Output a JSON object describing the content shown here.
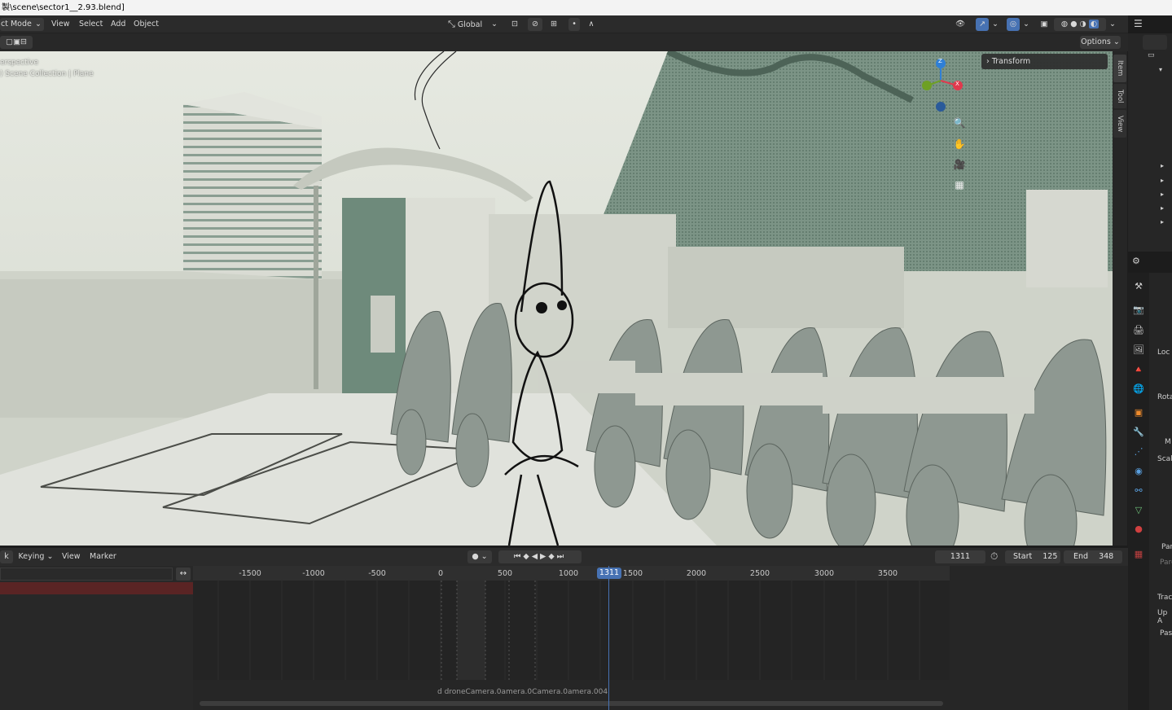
{
  "window": {
    "title": "製\\scene\\sector1__2.93.blend]"
  },
  "header": {
    "mode": "ct Mode",
    "menus": [
      "View",
      "Select",
      "Add",
      "Object"
    ],
    "transform_orientation": "Global",
    "options_label": "Options"
  },
  "viewport": {
    "view_name": "erspective",
    "collection_path": ") Scene Collection | Plane",
    "side_tabs": [
      "Item",
      "Tool",
      "View"
    ],
    "transform_panel": "Transform",
    "axes": {
      "z": "Z",
      "y": "Y",
      "x": "X"
    }
  },
  "timeline": {
    "menus": [
      "k",
      "Keying",
      "View",
      "Marker"
    ],
    "current_frame": "1311",
    "current_frame_field": "1311",
    "start_label": "Start",
    "start_value": "125",
    "end_label": "End",
    "end_value": "348",
    "ticks": [
      "-1500",
      "-1000",
      "-500",
      "0",
      "500",
      "1000",
      "1500",
      "2000",
      "2500",
      "3000",
      "3500"
    ],
    "marker_text": "d droneCamera.0amera.0Camera.0amera.004"
  },
  "properties": {
    "labels": [
      "Loc",
      "Rota",
      "M",
      "Scal",
      "Par",
      "Pare",
      "Trac",
      "Up A",
      "Pas"
    ]
  },
  "colors": {
    "accent": "#4772b3",
    "playhead": "#4772b3",
    "x_axis": "#e0394d",
    "y_axis": "#6ea024",
    "z_axis": "#2f7fd6",
    "track_red": "#5a2424"
  }
}
